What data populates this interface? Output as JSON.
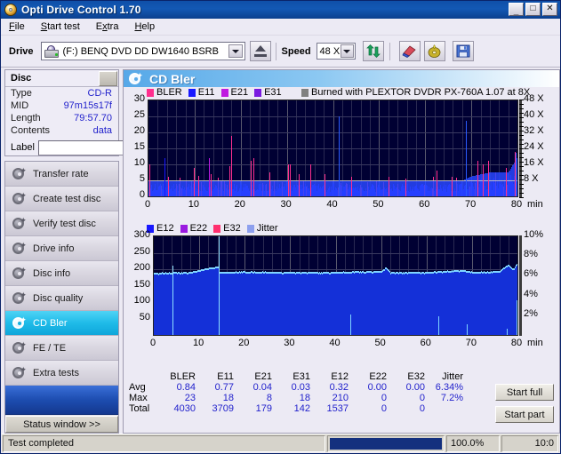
{
  "window": {
    "title": "Opti Drive Control 1.70",
    "icon": "disc-icon",
    "minimize": "_",
    "maximize": "□",
    "close": "✕"
  },
  "menu": {
    "items": [
      "File",
      "Start test",
      "Extra",
      "Help"
    ]
  },
  "toolbar": {
    "drive_label": "Drive",
    "drive_value": "(F:)   BENQ DVD DD DW1640 BSRB",
    "speed_label": "Speed",
    "speed_value": "48 X",
    "eject_icon": "eject-icon",
    "refresh_icon": "refresh-icon",
    "erase_icon": "erase-icon",
    "burn_icon": "burn-icon",
    "save_icon": "save-icon"
  },
  "disc": {
    "header": "Disc",
    "rows": [
      {
        "key": "Type",
        "value": "CD-R"
      },
      {
        "key": "MID",
        "value": "97m15s17f"
      },
      {
        "key": "Length",
        "value": "79:57.70"
      },
      {
        "key": "Contents",
        "value": "data"
      }
    ],
    "label_key": "Label",
    "label_value": ""
  },
  "nav": {
    "items": [
      {
        "label": "Transfer rate",
        "active": false
      },
      {
        "label": "Create test disc",
        "active": false
      },
      {
        "label": "Verify test disc",
        "active": false
      },
      {
        "label": "Drive info",
        "active": false
      },
      {
        "label": "Disc info",
        "active": false
      },
      {
        "label": "Disc quality",
        "active": false
      },
      {
        "label": "CD Bler",
        "active": true
      },
      {
        "label": "FE / TE",
        "active": false
      },
      {
        "label": "Extra tests",
        "active": false
      }
    ],
    "status_window_button": "Status window >>"
  },
  "main": {
    "title": "CD Bler",
    "burn_note": "Burned with PLEXTOR DVDR   PX-760A 1.07 at 8X",
    "start_full": "Start full",
    "start_part": "Start part"
  },
  "statusbar": {
    "text": "Test completed",
    "progress_percent": "100.0%",
    "progress_value": 100,
    "clock": "10:0"
  },
  "stats": {
    "columns": [
      "BLER",
      "E11",
      "E21",
      "E31",
      "E12",
      "E22",
      "E32",
      "Jitter"
    ],
    "rows": [
      {
        "label": "Avg",
        "values": [
          "0.84",
          "0.77",
          "0.04",
          "0.03",
          "0.32",
          "0.00",
          "0.00",
          "6.34%"
        ]
      },
      {
        "label": "Max",
        "values": [
          "23",
          "18",
          "8",
          "18",
          "210",
          "0",
          "0",
          "7.2%"
        ]
      },
      {
        "label": "Total",
        "values": [
          "4030",
          "3709",
          "179",
          "142",
          "1537",
          "0",
          "0",
          ""
        ]
      }
    ]
  },
  "chart_data": [
    {
      "type": "line",
      "name": "bler-chart",
      "title": "",
      "xlabel": "min",
      "ylabel": "",
      "xlim": [
        0,
        80
      ],
      "ylim": [
        0,
        30
      ],
      "yticks": [
        0,
        5,
        10,
        15,
        20,
        25,
        30
      ],
      "xticks": [
        0,
        10,
        20,
        30,
        40,
        50,
        60,
        70,
        80
      ],
      "right_axis": {
        "label": "X",
        "ticks": [
          "8 X",
          "16 X",
          "24 X",
          "32 X",
          "40 X",
          "48 X"
        ],
        "lim": [
          0,
          48
        ]
      },
      "legend": [
        {
          "name": "BLER",
          "color": "#ff2f8e"
        },
        {
          "name": "E11",
          "color": "#1818ff"
        },
        {
          "name": "E21",
          "color": "#c01ae0"
        },
        {
          "name": "E31",
          "color": "#7a1ae0"
        },
        {
          "name": "Burned with PLEXTOR DVDR   PX-760A 1.07 at 8X",
          "color": "#808080"
        }
      ],
      "annotations": [
        "avg line at 5"
      ],
      "grid": true,
      "series": [
        {
          "name": "BLER",
          "color": "#ff2f8e",
          "avg": 0.84,
          "max": 23,
          "total": 4030
        },
        {
          "name": "E11",
          "color": "#1818ff",
          "avg": 0.77,
          "max": 18,
          "total": 3709
        },
        {
          "name": "E21",
          "color": "#c01ae0",
          "avg": 0.04,
          "max": 8,
          "total": 179
        },
        {
          "name": "E31",
          "color": "#7a1ae0",
          "avg": 0.03,
          "max": 18,
          "total": 142
        }
      ],
      "bler_trace": [
        8,
        3,
        2,
        3,
        2,
        4,
        3,
        2,
        3,
        2,
        4,
        3,
        2,
        3,
        2,
        3,
        4,
        3,
        2,
        3,
        4,
        3,
        2,
        3,
        2,
        3,
        4,
        2,
        3,
        2,
        4,
        3,
        2,
        5,
        3,
        2,
        3,
        2,
        4,
        3,
        2,
        3,
        2,
        3,
        2,
        4,
        3,
        2,
        3,
        2,
        3,
        4,
        2,
        3,
        2,
        3,
        2,
        4,
        3,
        2,
        3,
        2,
        4,
        3,
        2,
        3,
        2,
        3,
        4,
        2,
        3,
        2,
        4,
        3,
        2,
        3,
        2,
        3,
        2,
        3
      ],
      "spikes": [
        {
          "x": 0.2,
          "y": 10,
          "color": "#ff2f8e"
        },
        {
          "x": 3.4,
          "y": 12,
          "color": "#1818ff"
        },
        {
          "x": 4.2,
          "y": 6,
          "color": "#ff2f8e"
        },
        {
          "x": 9.8,
          "y": 9,
          "color": "#ff2f8e"
        },
        {
          "x": 10.8,
          "y": 6.5,
          "color": "#ff2f8e"
        },
        {
          "x": 13.2,
          "y": 12,
          "color": "#c01ae0"
        },
        {
          "x": 13.4,
          "y": 7,
          "color": "#ff2f8e"
        },
        {
          "x": 17.5,
          "y": 9.5,
          "color": "#ff2f8e"
        },
        {
          "x": 18.0,
          "y": 19,
          "color": "#ff2f8e"
        },
        {
          "x": 22.2,
          "y": 11,
          "color": "#ff2f8e"
        },
        {
          "x": 22.8,
          "y": 12,
          "color": "#ff2f8e"
        },
        {
          "x": 26.2,
          "y": 7.5,
          "color": "#ff2f8e"
        },
        {
          "x": 30.3,
          "y": 10,
          "color": "#ff2f8e"
        },
        {
          "x": 30.6,
          "y": 10,
          "color": "#ff2f8e"
        },
        {
          "x": 32.6,
          "y": 7,
          "color": "#ff2f8e"
        },
        {
          "x": 35.0,
          "y": 10,
          "color": "#ff2f8e"
        },
        {
          "x": 38.2,
          "y": 7,
          "color": "#ff2f8e"
        },
        {
          "x": 41.2,
          "y": 23,
          "color": "#ff2f8e"
        },
        {
          "x": 44.0,
          "y": 6,
          "color": "#ff2f8e"
        },
        {
          "x": 52.0,
          "y": 6,
          "color": "#ff2f8e"
        },
        {
          "x": 55.8,
          "y": 5.5,
          "color": "#ff2f8e"
        },
        {
          "x": 62.5,
          "y": 8,
          "color": "#ff2f8e"
        },
        {
          "x": 65.8,
          "y": 6,
          "color": "#ff2f8e"
        },
        {
          "x": 68.9,
          "y": 22,
          "color": "#ff2f8e"
        },
        {
          "x": 71.3,
          "y": 11,
          "color": "#ff2f8e"
        },
        {
          "x": 72.5,
          "y": 10,
          "color": "#ff2f8e"
        },
        {
          "x": 73.6,
          "y": 11,
          "color": "#ff2f8e"
        },
        {
          "x": 77.5,
          "y": 9,
          "color": "#ff2f8e"
        },
        {
          "x": 79.5,
          "y": 14,
          "color": "#ff2f8e"
        }
      ],
      "speed_curve": [
        {
          "x": 0,
          "y": 8
        },
        {
          "x": 10,
          "y": 8
        },
        {
          "x": 20,
          "y": 8
        },
        {
          "x": 30,
          "y": 8
        },
        {
          "x": 40,
          "y": 8
        },
        {
          "x": 50,
          "y": 8
        },
        {
          "x": 60,
          "y": 8
        },
        {
          "x": 68,
          "y": 8
        },
        {
          "x": 70,
          "y": 10
        },
        {
          "x": 74,
          "y": 12
        },
        {
          "x": 78,
          "y": 12
        },
        {
          "x": 80,
          "y": 20
        }
      ]
    },
    {
      "type": "line",
      "name": "e12-jitter-chart",
      "title": "",
      "xlabel": "min",
      "ylabel": "",
      "xlim": [
        0,
        80
      ],
      "ylim": [
        0,
        300
      ],
      "yticks": [
        0,
        50,
        100,
        150,
        200,
        250,
        300
      ],
      "xticks": [
        0,
        10,
        20,
        30,
        40,
        50,
        60,
        70,
        80
      ],
      "right_axis": {
        "label": "%",
        "ticks": [
          "2%",
          "4%",
          "6%",
          "8%",
          "10%"
        ],
        "lim": [
          0,
          10
        ]
      },
      "legend": [
        {
          "name": "E12",
          "color": "#1818ff"
        },
        {
          "name": "E22",
          "color": "#9a1ae0"
        },
        {
          "name": "E32",
          "color": "#ff2f6e"
        },
        {
          "name": "Jitter",
          "color": "#8ea0ee"
        }
      ],
      "grid": true,
      "series": [
        {
          "name": "E12",
          "color": "#1818ff",
          "avg": 0.32,
          "max": 210,
          "total": 1537
        },
        {
          "name": "E22",
          "color": "#9a1ae0",
          "avg": 0.0,
          "max": 0,
          "total": 0
        },
        {
          "name": "E32",
          "color": "#ff2f6e",
          "avg": 0.0,
          "max": 0,
          "total": 0
        },
        {
          "name": "Jitter",
          "color": "#8ea0ee",
          "avg": "6.34%",
          "max": "7.2%"
        }
      ],
      "jitter_trace": [
        {
          "x": 0,
          "y": 6.2
        },
        {
          "x": 4,
          "y": 6.25
        },
        {
          "x": 8,
          "y": 6.3
        },
        {
          "x": 14,
          "y": 6.9
        },
        {
          "x": 14.5,
          "y": 6.3
        },
        {
          "x": 20,
          "y": 6.35
        },
        {
          "x": 30,
          "y": 6.3
        },
        {
          "x": 40,
          "y": 6.3
        },
        {
          "x": 50,
          "y": 6.4
        },
        {
          "x": 51,
          "y": 6.8
        },
        {
          "x": 52,
          "y": 6.3
        },
        {
          "x": 60,
          "y": 6.3
        },
        {
          "x": 68,
          "y": 6.5
        },
        {
          "x": 70,
          "y": 6.3
        },
        {
          "x": 76,
          "y": 6.4
        },
        {
          "x": 78,
          "y": 7.1
        },
        {
          "x": 79,
          "y": 6.6
        },
        {
          "x": 80,
          "y": 7.2
        }
      ],
      "e12_spikes": [
        {
          "x": 4.1,
          "y": 210
        },
        {
          "x": 14.2,
          "y": 70
        },
        {
          "x": 43.2,
          "y": 62
        },
        {
          "x": 62.5,
          "y": 58
        },
        {
          "x": 68.8,
          "y": 32
        },
        {
          "x": 77.6,
          "y": 18
        },
        {
          "x": 80.2,
          "y": 105
        }
      ]
    }
  ]
}
